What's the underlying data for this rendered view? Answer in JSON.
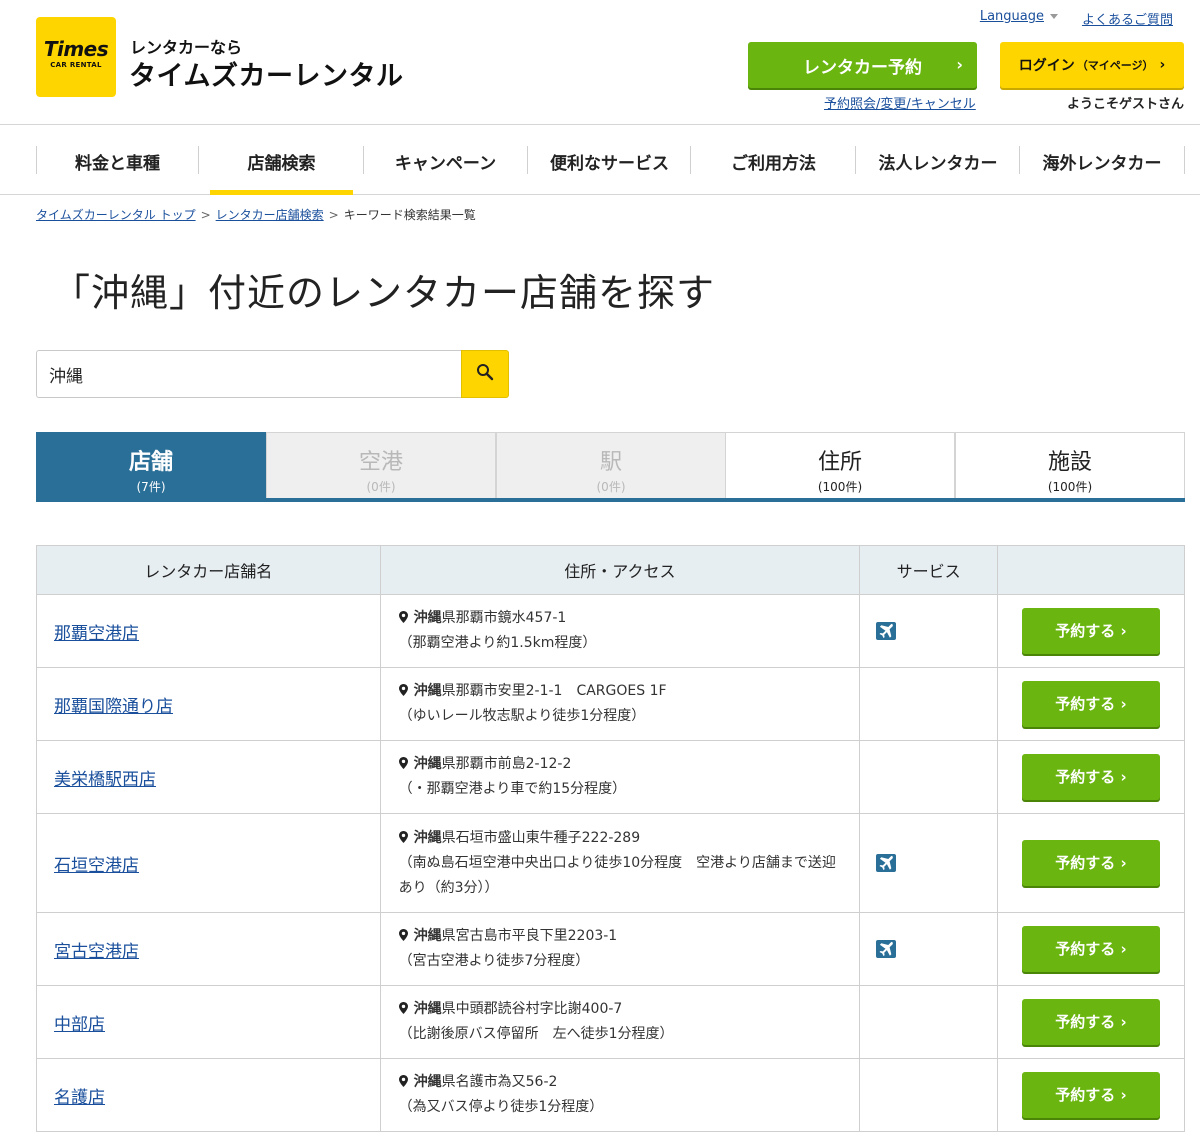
{
  "header": {
    "logo_text": "Times",
    "logo_sub": "CAR RENTAL",
    "tagline": "レンタカーなら",
    "brand": "タイムズカーレンタル",
    "language_label": "Language",
    "faq_label": "よくあるご質問",
    "reserve_button": "レンタカー予約",
    "login_button": "ログイン",
    "login_sub": "（マイページ）",
    "reservation_link": "予約照会/変更/キャンセル",
    "welcome": "ようこそゲストさん"
  },
  "nav": [
    {
      "label": "料金と車種"
    },
    {
      "label": "店舗検索",
      "active": true
    },
    {
      "label": "キャンペーン"
    },
    {
      "label": "便利なサービス"
    },
    {
      "label": "ご利用方法"
    },
    {
      "label": "法人レンタカー"
    },
    {
      "label": "海外レンタカー"
    }
  ],
  "breadcrumb": [
    "タイムズカーレンタル トップ",
    "レンタカー店舗検索",
    "キーワード検索結果一覧"
  ],
  "page_title": "「沖縄」付近のレンタカー店舗を探す",
  "search": {
    "value": "沖縄"
  },
  "tabs": [
    {
      "label": "店舗",
      "count": "(7件)",
      "state": "active"
    },
    {
      "label": "空港",
      "count": "(0件)",
      "state": "disabled"
    },
    {
      "label": "駅",
      "count": "(0件)",
      "state": "disabled"
    },
    {
      "label": "住所",
      "count": "(100件)",
      "state": "normal"
    },
    {
      "label": "施設",
      "count": "(100件)",
      "state": "normal"
    }
  ],
  "table": {
    "headers": [
      "レンタカー店舗名",
      "住所・アクセス",
      "サービス",
      ""
    ],
    "reserve_label": "予約する",
    "rows": [
      {
        "name": "那覇空港店",
        "pref": "沖縄",
        "addr": "県那覇市鏡水457-1",
        "access": "（那覇空港より約1.5km程度）",
        "airport": true
      },
      {
        "name": "那覇国際通り店",
        "pref": "沖縄",
        "addr": "県那覇市安里2-1-1　CARGOES 1F",
        "access": "（ゆいレール牧志駅より徒歩1分程度）",
        "airport": false
      },
      {
        "name": "美栄橋駅西店",
        "pref": "沖縄",
        "addr": "県那覇市前島2-12-2",
        "access": "（・那覇空港より車で約15分程度）",
        "airport": false
      },
      {
        "name": "石垣空港店",
        "pref": "沖縄",
        "addr": "県石垣市盛山東牛種子222-289",
        "access": "（南ぬ島石垣空港中央出口より徒歩10分程度　空港より店舗まで送迎あり（約3分））",
        "airport": true
      },
      {
        "name": "宮古空港店",
        "pref": "沖縄",
        "addr": "県宮古島市平良下里2203-1",
        "access": "（宮古空港より徒歩7分程度）",
        "airport": true
      },
      {
        "name": "中部店",
        "pref": "沖縄",
        "addr": "県中頭郡読谷村字比謝400-7",
        "access": "（比謝後原バス停留所　左へ徒歩1分程度）",
        "airport": false
      },
      {
        "name": "名護店",
        "pref": "沖縄",
        "addr": "県名護市為又56-2",
        "access": "（為又バス停より徒歩1分程度）",
        "airport": false
      }
    ]
  },
  "colors": {
    "brand_yellow": "#ffd500",
    "action_green": "#6ab50f",
    "tab_blue": "#2a6f98",
    "link_blue": "#1a4f9c"
  },
  "icons": {
    "search": "search-icon",
    "pin": "map-pin-icon",
    "airport": "airplane-icon",
    "chevron": "chevron-right-icon"
  }
}
